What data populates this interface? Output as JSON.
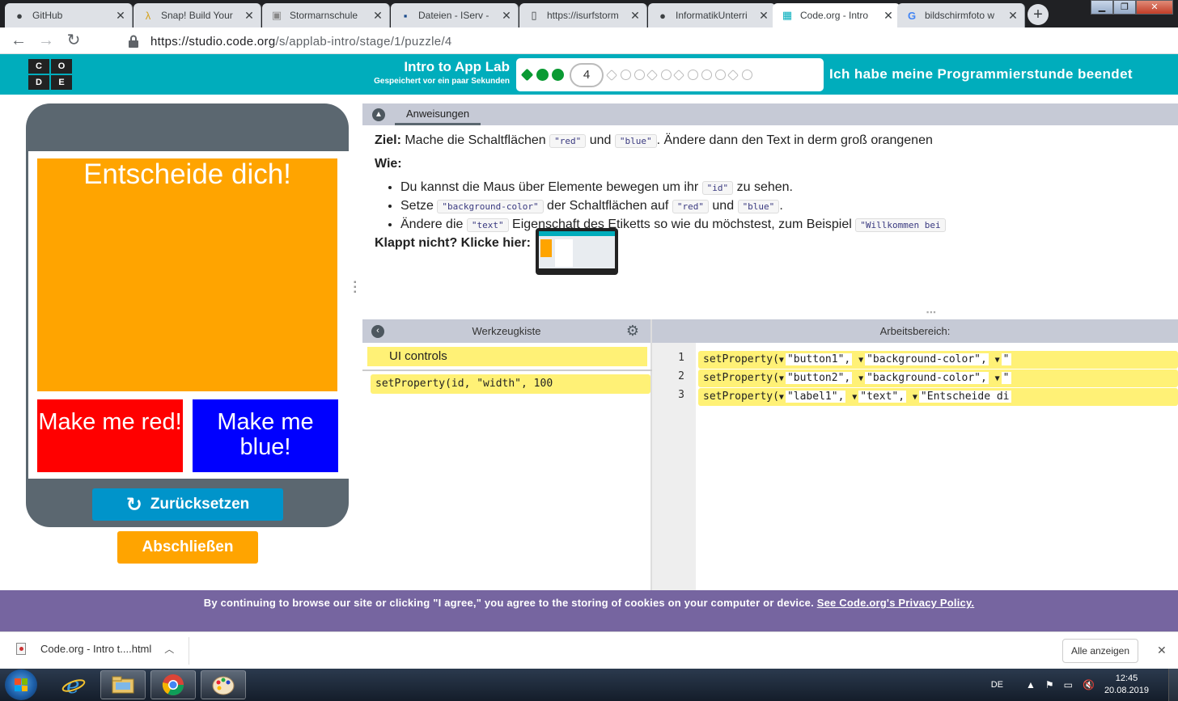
{
  "browser": {
    "tabs": [
      {
        "title": "GitHub",
        "icon": "github-icon",
        "active": false
      },
      {
        "title": "Snap! Build Your",
        "icon": "lambda-icon",
        "active": false
      },
      {
        "title": "Stormarnschule",
        "icon": "image-icon",
        "active": false
      },
      {
        "title": "Dateien - IServ -",
        "icon": "iserv-icon",
        "active": false
      },
      {
        "title": "https://isurfstorm",
        "icon": "page-icon",
        "active": false
      },
      {
        "title": "InformatikUnterri",
        "icon": "github-icon",
        "active": false
      },
      {
        "title": "Code.org - Intro",
        "icon": "codeorg-icon",
        "active": true
      },
      {
        "title": "bildschirmfoto w",
        "icon": "google-icon",
        "active": false
      }
    ],
    "url_host": "https://studio.code.org",
    "url_path": "/s/applab-intro/stage/1/puzzle/4"
  },
  "header": {
    "logo_letters": [
      "C",
      "O",
      "D",
      "E"
    ],
    "lesson_title": "Intro to App Lab",
    "save_status": "Gespeichert vor ein paar Sekunden",
    "current_level": "4",
    "completed_levels": 3,
    "remaining_levels": 11,
    "finished_message": "Ich habe meine Programmierstunde beendet"
  },
  "app": {
    "label_text": "Entscheide dich!",
    "button_red": "Make me red!",
    "button_blue": "Make me blue!",
    "label_color": "#ffa400",
    "red_color": "#ff0000",
    "blue_color": "#0000ff",
    "reset_label": "Zurücksetzen",
    "finish_label": "Abschließen"
  },
  "instructions": {
    "tab_label": "Anweisungen",
    "goal_heading": "Ziel:",
    "goal_text_1": "Mache die Schaltflächen",
    "goal_code_1": "\"red\"",
    "goal_text_2": "und",
    "goal_code_2": "\"blue\"",
    "goal_text_3": ". Ändere dann den Text in derm groß orangenen",
    "how_heading": "Wie:",
    "bullet1_text_1": "Du kannst die Maus über Elemente bewegen um ihr",
    "bullet1_code": "\"id\"",
    "bullet1_text_2": "zu sehen.",
    "bullet2_text_1": "Setze",
    "bullet2_code_1": "\"background-color\"",
    "bullet2_text_2": "der Schaltflächen auf",
    "bullet2_code_2": "\"red\"",
    "bullet2_text_3": "und",
    "bullet2_code_3": "\"blue\"",
    "bullet2_text_4": ".",
    "bullet3_text_1": "Ändere die",
    "bullet3_code_1": "\"text\"",
    "bullet3_text_2": "Eigenschaft des Etiketts so wie du möchstest, zum Beispiel",
    "bullet3_code_2": "\"Willkommen bei",
    "help_text": "Klappt nicht? Klicke hier:"
  },
  "toolbox": {
    "title": "Werkzeugkiste",
    "category": "UI controls",
    "block_text": "setProperty(id, \"width\", 100"
  },
  "workspace": {
    "title": "Arbeitsbereich:",
    "lines": [
      {
        "num": "1",
        "fn": "setProperty(",
        "arg1": "\"button1\",",
        "arg2": "\"background-color\",",
        "arg3": "\""
      },
      {
        "num": "2",
        "fn": "setProperty(",
        "arg1": "\"button2\",",
        "arg2": "\"background-color\",",
        "arg3": "\""
      },
      {
        "num": "3",
        "fn": "setProperty(",
        "arg1": "\"label1\",",
        "arg2": "\"text\",",
        "arg3": "\"Entscheide di"
      }
    ]
  },
  "cookie_banner": {
    "text": "By continuing to browse our site or clicking \"I agree,\" you agree to the storing of cookies on your computer or device.",
    "link": "See Code.org's Privacy Policy."
  },
  "downloads": {
    "file_name": "Code.org - Intro t....html",
    "show_all": "Alle anzeigen"
  },
  "taskbar": {
    "language": "DE",
    "time": "12:45",
    "date": "20.08.2019"
  }
}
